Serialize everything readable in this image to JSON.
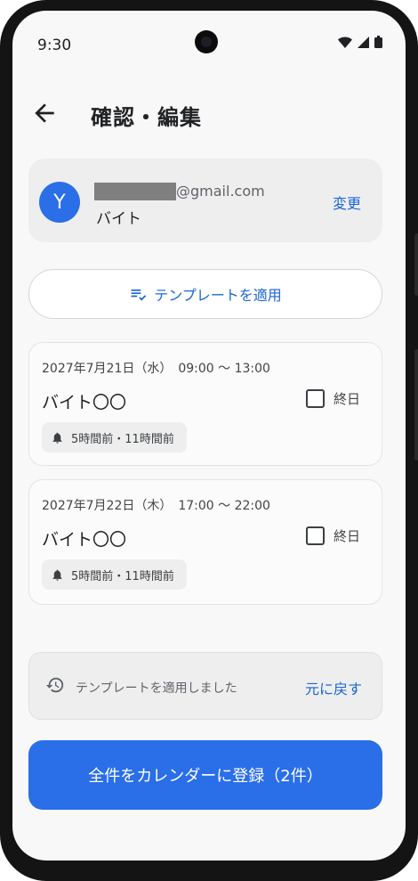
{
  "status_bar": {
    "time": "9:30"
  },
  "header": {
    "title": "確認・編集"
  },
  "account": {
    "avatar_initial": "Y",
    "email_suffix": "@gmail.com",
    "calendar_name": "バイト",
    "change_label": "変更"
  },
  "template_button": {
    "label": "テンプレートを適用"
  },
  "events": [
    {
      "datetime": "2027年7月21日（水）　09:00 〜 13:00",
      "title": "バイト〇〇",
      "allday_label": "終日",
      "reminder": "5時間前・11時間前"
    },
    {
      "datetime": "2027年7月22日（木）　17:00 〜 22:00",
      "title": "バイト〇〇",
      "allday_label": "終日",
      "reminder": "5時間前・11時間前"
    }
  ],
  "snackbar": {
    "message": "テンプレートを適用しました",
    "action": "元に戻す"
  },
  "register_button": {
    "label": "全件をカレンダーに登録（2件）"
  },
  "colors": {
    "accent": "#2a6ee8",
    "link": "#1a66d4",
    "background": "#f8f8f8"
  },
  "icons": [
    "back-arrow-icon",
    "wifi-icon",
    "signal-icon",
    "battery-icon",
    "playlist-check-icon",
    "bell-icon",
    "history-icon"
  ]
}
